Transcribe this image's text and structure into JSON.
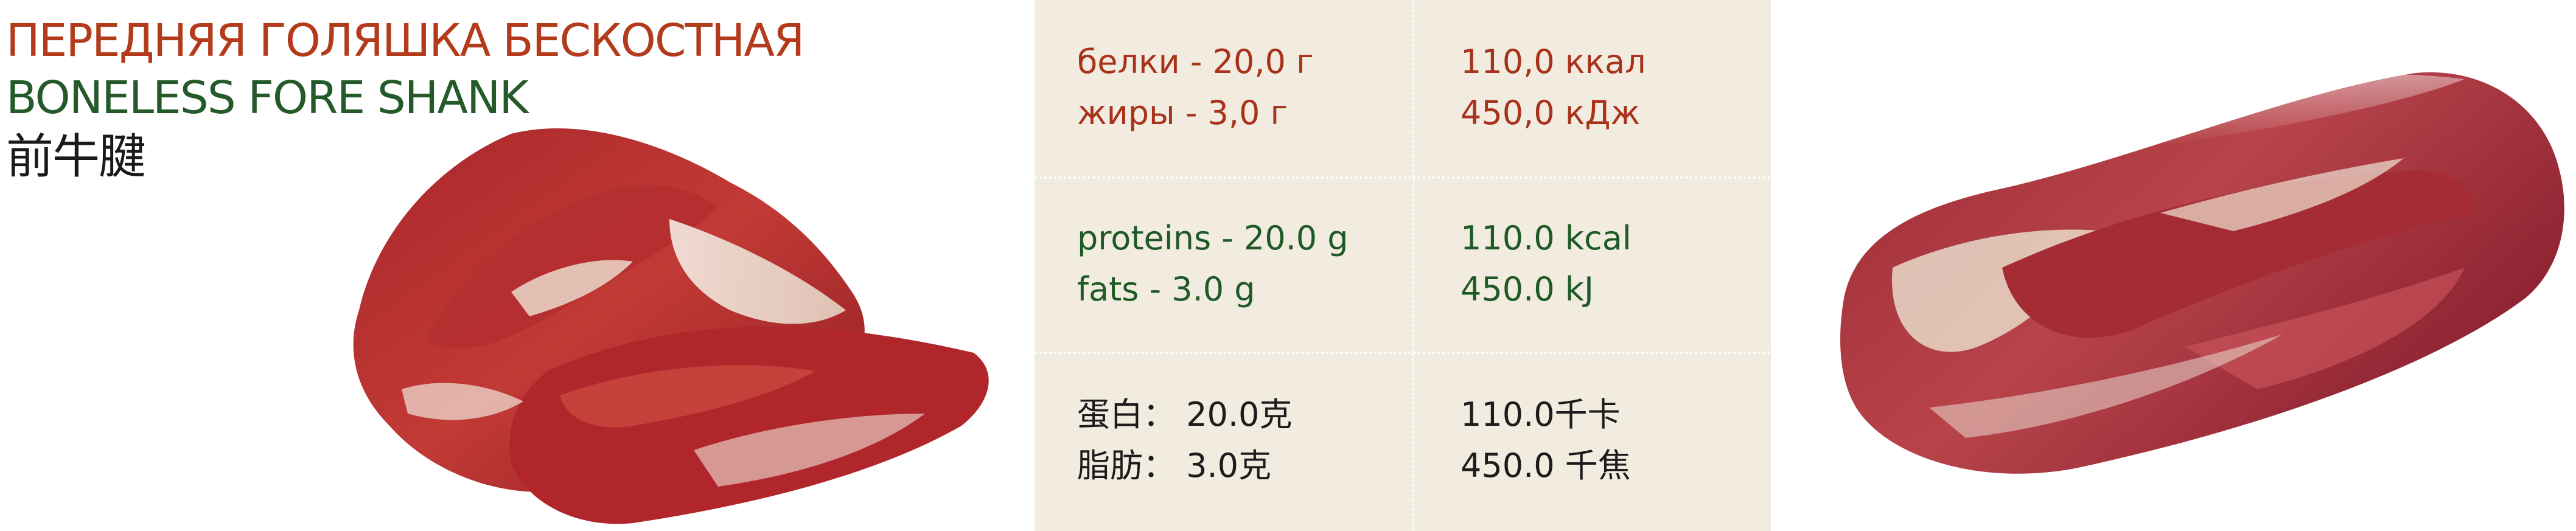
{
  "title": {
    "ru": "ПЕРЕДНЯЯ ГОЛЯШКА БЕСКОСТНАЯ",
    "en": "BONELESS FORE SHANK",
    "cn": "前牛腱"
  },
  "nutrition": {
    "ru": {
      "proteins": "белки - 20,0 г",
      "fats": "жиры -  3,0 г",
      "kcal": "110,0 ккал",
      "kj": "450,0 кДж"
    },
    "en": {
      "proteins": "proteins - 20.0 g",
      "fats": "fats - 3.0 g",
      "kcal": "110.0 kcal",
      "kj": "450.0 kJ"
    },
    "cn": {
      "proteins": "蛋白： 20.0克",
      "fats": "脂肪： 3.0克",
      "kcal": "110.0千卡",
      "kj": "450.0 千焦"
    }
  },
  "colors": {
    "ru_text": "#a8321a",
    "en_text": "#1f5a26",
    "cn_text": "#1c1c1c",
    "panel_bg": "#f2ebe0"
  },
  "images": {
    "left": "boneless-fore-shank-cut-photo",
    "right": "vacuum-packed-fore-shank-photo"
  }
}
